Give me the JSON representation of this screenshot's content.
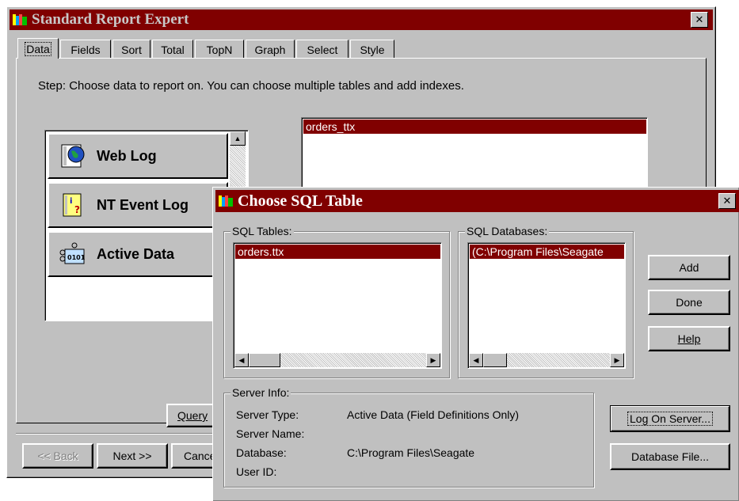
{
  "main_window": {
    "title": "Standard Report Expert",
    "tabs": [
      "Data",
      "Fields",
      "Sort",
      "Total",
      "TopN",
      "Graph",
      "Select",
      "Style"
    ],
    "step_text": "Step: Choose data to report on. You can choose multiple tables and add indexes.",
    "data_sources": [
      {
        "label": "Web Log",
        "icon": "globe-icon"
      },
      {
        "label": "NT Event Log",
        "icon": "event-log-icon"
      },
      {
        "label": "Active Data",
        "icon": "active-data-icon"
      }
    ],
    "selected_tables": [
      "orders_ttx"
    ],
    "query_button": "Query",
    "back_button": "<< Back",
    "next_button": "Next >>",
    "cancel_button": "Cancel"
  },
  "dialog": {
    "title": "Choose SQL Table",
    "sql_tables_label": "SQL Tables:",
    "sql_tables": [
      "orders.ttx"
    ],
    "sql_databases_label": "SQL Databases:",
    "sql_databases": [
      "(C:\\Program Files\\Seagate"
    ],
    "add_button": "Add",
    "done_button": "Done",
    "help_button": "Help",
    "server_info_label": "Server Info:",
    "server_type_label": "Server Type:",
    "server_type_value": "Active Data (Field Definitions Only)",
    "server_name_label": "Server Name:",
    "server_name_value": "",
    "database_label": "Database:",
    "database_value": "C:\\Program Files\\Seagate",
    "user_id_label": "User ID:",
    "user_id_value": "",
    "log_on_button": "Log On Server...",
    "database_file_button": "Database File..."
  },
  "colors": {
    "titlebar": "#800000",
    "face": "#c0c0c0",
    "selection": "#800000"
  }
}
